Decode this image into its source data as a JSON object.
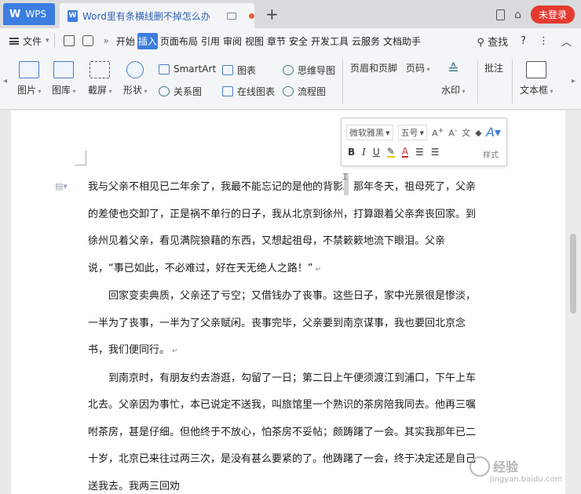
{
  "titlebar": {
    "app_tab_label": "WPS",
    "doc_tab_title": "Word里有条横线删不掉怎么办",
    "login_label": "未登录",
    "new_tab_glyph": "+"
  },
  "menubar": {
    "file_label": "文件",
    "tabs": [
      "开始",
      "插入",
      "页面布局",
      "引用",
      "审阅",
      "视图",
      "章节",
      "安全",
      "开发工具",
      "云服务",
      "文档助手"
    ],
    "active_tab": "插入",
    "search_label": "查找",
    "help_glyph": "?",
    "more_glyph": "⋮",
    "collapse_glyph": "︿"
  },
  "ribbon": {
    "big_buttons": [
      "图片",
      "图库",
      "截屏",
      "形状",
      "页眉和页脚",
      "页码",
      "水印",
      "批注",
      "文本框"
    ],
    "small_buttons": [
      "SmartArt",
      "关系图",
      "图表",
      "在线图表",
      "思维导图",
      "流程图"
    ]
  },
  "mini_toolbar": {
    "font_name": "微软雅黑",
    "font_size": "五号",
    "style_label": "样式"
  },
  "document": {
    "paragraphs": [
      "我与父亲不相见已二年余了，我最不能忘记的是他的背影。那年冬天，祖母死了，父亲的差使也交卸了，正是祸不单行的日子，我从北京到徐州，打算跟着父亲奔丧回家。到徐州见着父亲，看见满院狼藉的东西，又想起祖母，不禁簌簌地流下眼泪。父亲说，“事已如此，不必难过，好在天无绝人之路！”",
      "回家变卖典质，父亲还了亏空；又借钱办了丧事。这些日子，家中光景很是惨淡，一半为了丧事，一半为了父亲赋闲。丧事完毕，父亲要到南京谋事，我也要回北京念书，我们便同行。",
      "到南京时，有朋友约去游逛，勾留了一日；第二日上午便须渡江到浦口，下午上车北去。父亲因为事忙，本已说定不送我，叫旅馆里一个熟识的茶房陪我同去。他再三嘱咐茶房，甚是仔细。但他终于不放心，怕茶房不妥帖；颇踌躇了一会。其实我那年已二十岁，北京已来往过两三次，是没有甚么要紧的了。他踌躇了一会，终于决定还是自己送我去。我两三回劝"
    ]
  },
  "watermark": {
    "text": "经验",
    "url": "jingyan.baidu.com"
  },
  "colors": {
    "accent": "#3b7de0",
    "login_red": "#e53a30"
  }
}
